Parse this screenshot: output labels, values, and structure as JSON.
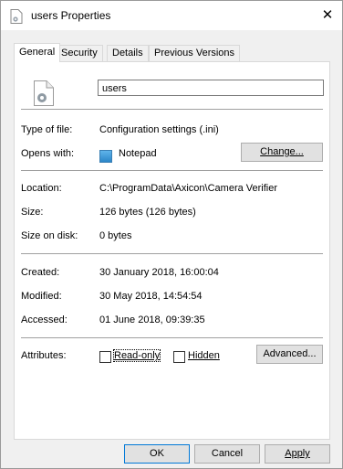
{
  "window": {
    "title": "users Properties",
    "close_glyph": "✕"
  },
  "tabs": [
    {
      "label": "General"
    },
    {
      "label": "Security"
    },
    {
      "label": "Details"
    },
    {
      "label": "Previous Versions"
    }
  ],
  "general": {
    "filename": "users",
    "type_of_file_label": "Type of file:",
    "type_of_file_value": "Configuration settings (.ini)",
    "opens_with_label": "Opens with:",
    "opens_with_value": "Notepad",
    "change_button": "Change...",
    "location_label": "Location:",
    "location_value": "C:\\ProgramData\\Axicon\\Camera Verifier",
    "size_label": "Size:",
    "size_value": "126 bytes (126 bytes)",
    "size_on_disk_label": "Size on disk:",
    "size_on_disk_value": "0 bytes",
    "created_label": "Created:",
    "created_value": "30 January 2018, 16:00:04",
    "modified_label": "Modified:",
    "modified_value": "30 May 2018, 14:54:54",
    "accessed_label": "Accessed:",
    "accessed_value": "01 June 2018, 09:39:35",
    "attributes_label": "Attributes:",
    "readonly_label": "Read-only",
    "readonly_checked": false,
    "hidden_label": "Hidden",
    "hidden_checked": false,
    "advanced_button": "Advanced..."
  },
  "footer": {
    "ok": "OK",
    "cancel": "Cancel",
    "apply": "Apply"
  },
  "colors": {
    "window_bg": "#f0f0f0",
    "panel_bg": "#ffffff",
    "button_bg": "#e1e1e1",
    "default_border": "#0078d7",
    "notepad_icon": "#2b86c8"
  },
  "icons": {
    "title": "settings-file-icon",
    "file": "settings-file-icon",
    "notepad": "notepad-icon",
    "close": "close-icon"
  }
}
